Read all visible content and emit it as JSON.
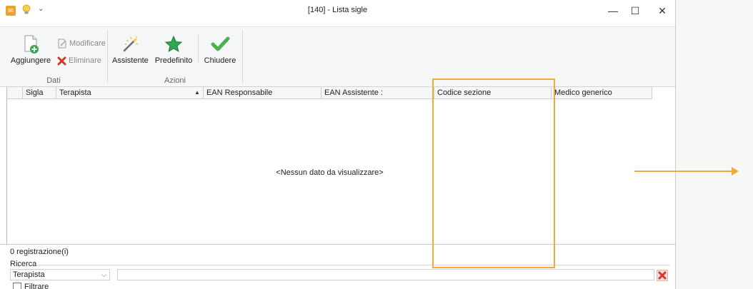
{
  "window": {
    "title": "[140] - Lista sigle"
  },
  "title_controls": {
    "minimize": "—",
    "maximize": "☐",
    "close": "✕"
  },
  "quick_access": {
    "arrow": "⌄"
  },
  "ribbon": {
    "group_dati": {
      "label": "Dati",
      "add": "Aggiungere",
      "edit": "Modificare",
      "delete": "Eliminare"
    },
    "group_azioni": {
      "label": "Azioni",
      "assistant": "Assistente",
      "default": "Predefinito",
      "close": "Chiudere"
    }
  },
  "grid": {
    "columns": [
      "Sigla",
      "Terapista",
      "EAN Responsabile",
      "EAN Assistente :",
      "Codice sezione",
      "Medico generico"
    ],
    "sort_indicator": "▲",
    "empty_message": "<Nessun dato da visualizzare>"
  },
  "status": {
    "records": "0 registrazione(i)"
  },
  "search": {
    "label": "Ricerca",
    "field_selected": "Terapista",
    "field_arrow": "⌵",
    "value": ""
  },
  "filter": {
    "label": "Filtrare",
    "checked": false
  },
  "colors": {
    "accent_orange": "#f2ac36",
    "delete_red": "#d9342b",
    "add_green": "#3aa655",
    "check_green": "#4caf50"
  }
}
